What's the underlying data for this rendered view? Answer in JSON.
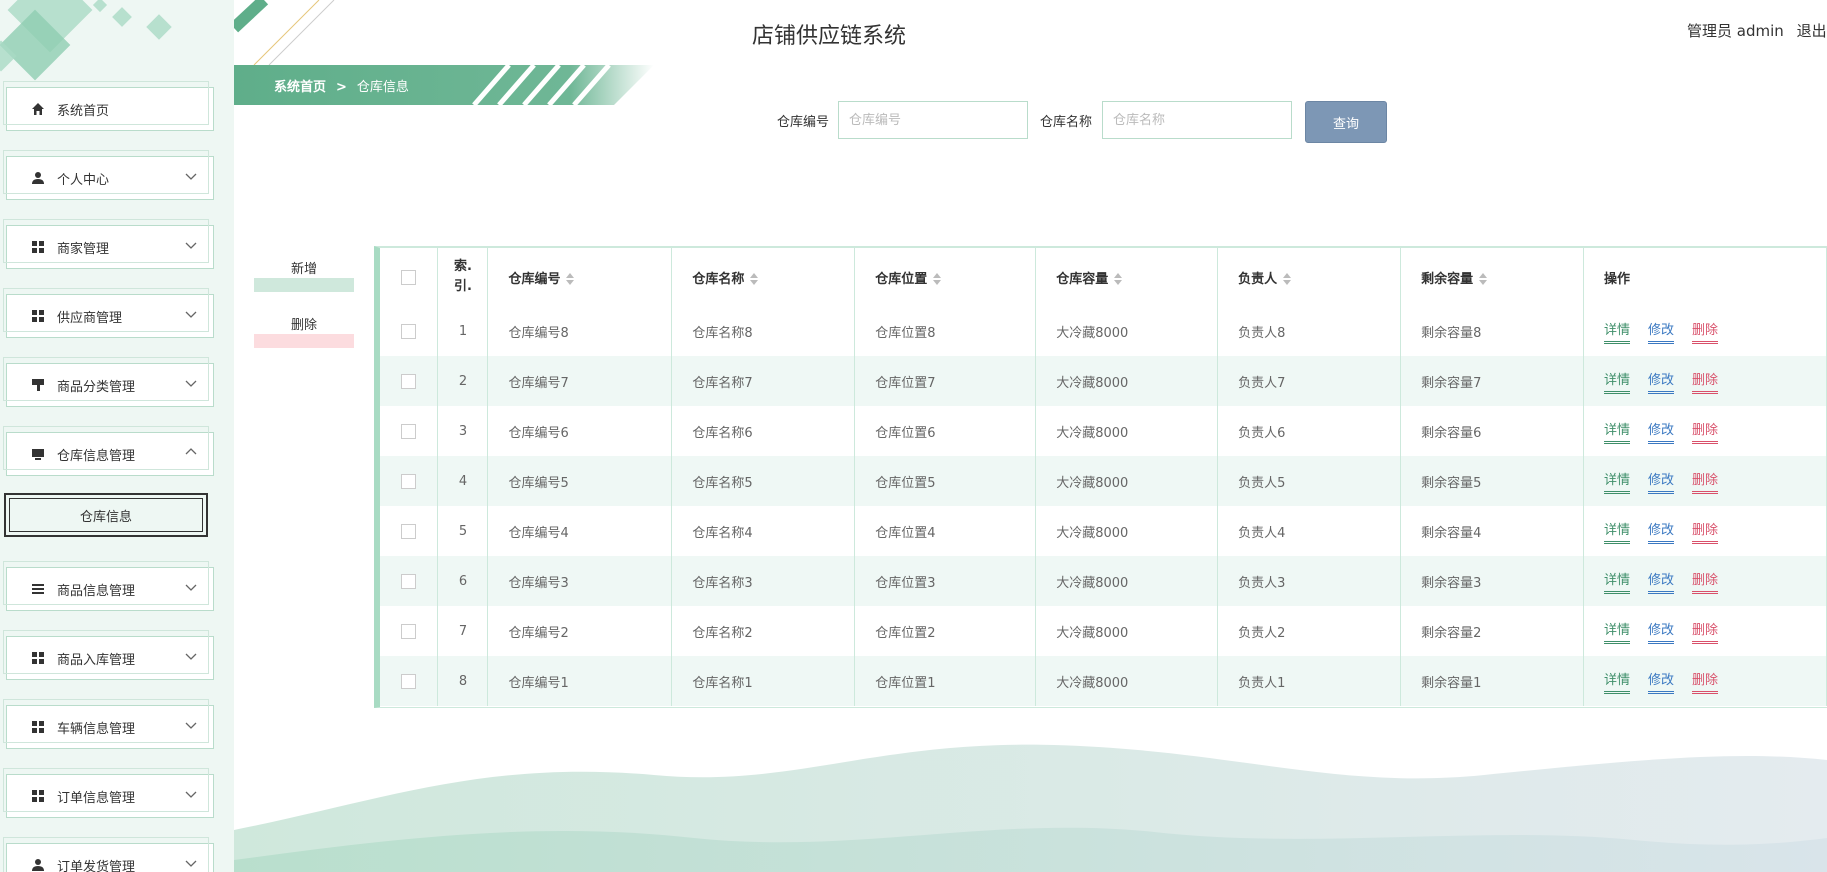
{
  "app": {
    "title": "店铺供应链系统",
    "user": {
      "label": "管理员 admin",
      "logout": "退出"
    }
  },
  "sidebar": {
    "items": [
      {
        "label": "系统首页",
        "icon": "home-icon"
      },
      {
        "label": "个人中心",
        "icon": "user-icon"
      },
      {
        "label": "商家管理",
        "icon": "grid-icon"
      },
      {
        "label": "供应商管理",
        "icon": "grid-icon"
      },
      {
        "label": "商品分类管理",
        "icon": "brush-icon"
      },
      {
        "label": "仓库信息管理",
        "icon": "monitor-icon"
      },
      {
        "label": "商品信息管理",
        "icon": "list-icon"
      },
      {
        "label": "商品入库管理",
        "icon": "grid-icon"
      },
      {
        "label": "车辆信息管理",
        "icon": "grid-icon"
      },
      {
        "label": "订单信息管理",
        "icon": "grid-icon"
      },
      {
        "label": "订单发货管理",
        "icon": "user-icon"
      }
    ],
    "active_sub": "仓库信息"
  },
  "breadcrumb": {
    "home": "系统首页",
    "sep": ">",
    "current": "仓库信息"
  },
  "search": {
    "code_label": "仓库编号",
    "code_placeholder": "仓库编号",
    "name_label": "仓库名称",
    "name_placeholder": "仓库名称",
    "button": "查询"
  },
  "actions": {
    "add": "新增",
    "delete": "删除"
  },
  "table": {
    "headers": [
      "索引",
      "仓库编号",
      "仓库名称",
      "仓库位置",
      "仓库容量",
      "负责人",
      "剩余容量",
      "操作"
    ],
    "index_header_lines": [
      "索.",
      "引."
    ],
    "rows": [
      {
        "idx": "1",
        "code": "仓库编号8",
        "name": "仓库名称8",
        "loc": "仓库位置8",
        "cap": "大冷藏8000",
        "owner": "负责人8",
        "remain": "剩余容量8"
      },
      {
        "idx": "2",
        "code": "仓库编号7",
        "name": "仓库名称7",
        "loc": "仓库位置7",
        "cap": "大冷藏8000",
        "owner": "负责人7",
        "remain": "剩余容量7"
      },
      {
        "idx": "3",
        "code": "仓库编号6",
        "name": "仓库名称6",
        "loc": "仓库位置6",
        "cap": "大冷藏8000",
        "owner": "负责人6",
        "remain": "剩余容量6"
      },
      {
        "idx": "4",
        "code": "仓库编号5",
        "name": "仓库名称5",
        "loc": "仓库位置5",
        "cap": "大冷藏8000",
        "owner": "负责人5",
        "remain": "剩余容量5"
      },
      {
        "idx": "5",
        "code": "仓库编号4",
        "name": "仓库名称4",
        "loc": "仓库位置4",
        "cap": "大冷藏8000",
        "owner": "负责人4",
        "remain": "剩余容量4"
      },
      {
        "idx": "6",
        "code": "仓库编号3",
        "name": "仓库名称3",
        "loc": "仓库位置3",
        "cap": "大冷藏8000",
        "owner": "负责人3",
        "remain": "剩余容量3"
      },
      {
        "idx": "7",
        "code": "仓库编号2",
        "name": "仓库名称2",
        "loc": "仓库位置2",
        "cap": "大冷藏8000",
        "owner": "负责人2",
        "remain": "剩余容量2"
      },
      {
        "idx": "8",
        "code": "仓库编号1",
        "name": "仓库名称1",
        "loc": "仓库位置1",
        "cap": "大冷藏8000",
        "owner": "负责人1",
        "remain": "剩余容量1"
      }
    ],
    "ops": {
      "detail": "详情",
      "edit": "修改",
      "delete": "删除"
    }
  },
  "colors": {
    "accent": "#5fae8a",
    "search_btn": "#7d97b5",
    "add_bar": "#cfe8dc",
    "delete_bar": "#fcdcdf",
    "detail": "#3f8f6a",
    "edit": "#3b79c2",
    "del": "#d9506a"
  }
}
